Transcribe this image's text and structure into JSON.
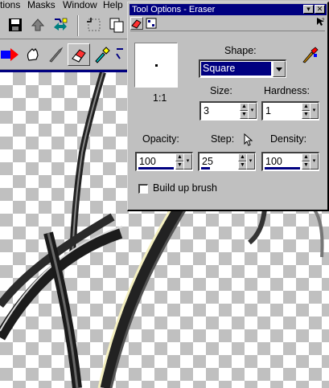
{
  "menubar": {
    "items": [
      "tions",
      "Masks",
      "Window",
      "Help"
    ]
  },
  "toolbar": {
    "icons": [
      "save-icon",
      "up-arrow-icon",
      "resize-icon",
      "crop-icon",
      "copy-icon"
    ]
  },
  "tools": {
    "icons": [
      "arrow-right-icon",
      "hand-icon",
      "knife-icon",
      "eraser-icon",
      "dropper-icon",
      "retouch-icon"
    ]
  },
  "tool_options": {
    "title": "Tool Options - Eraser",
    "tab_icons": [
      "eraser-tab-icon",
      "texture-tab-icon"
    ],
    "shape_label": "Shape:",
    "shape_value": "Square",
    "preview_ratio": "1:1",
    "size_label": "Size:",
    "size_value": "3",
    "hardness_label": "Hardness:",
    "hardness_value": "1",
    "opacity_label": "Opacity:",
    "opacity_value": "100",
    "step_label": "Step:",
    "step_value": "25",
    "density_label": "Density:",
    "density_value": "100",
    "build_up_label": "Build up brush",
    "build_up_checked": false
  },
  "colors": {
    "title_bar": "#000080",
    "face": "#c0c0c0",
    "checker_light": "#ffffff",
    "checker_dark": "#c0c0c0"
  }
}
